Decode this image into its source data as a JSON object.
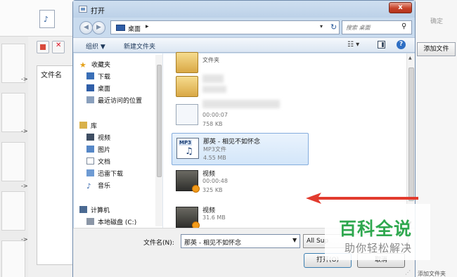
{
  "background": {
    "right_top_button": "确定",
    "add_file_button": "添加文件",
    "column_header": "文件名",
    "arrow_glyph": "->",
    "bottom_right_text": "添加文件夹"
  },
  "dialog": {
    "title": "打开",
    "close_glyph": "x",
    "address_location": "桌面",
    "search_placeholder": "搜索 桌面",
    "toolbar": {
      "organize": "组织 ▼",
      "new_folder": "新建文件夹",
      "view_glyph": "☷ ▾",
      "help_glyph": "?"
    },
    "nav_pane": {
      "favorites_header": "收藏夹",
      "favorites": [
        "下载",
        "桌面",
        "最近访问的位置"
      ],
      "libraries_header": "库",
      "libraries": [
        "视频",
        "图片",
        "文档",
        "迅雷下载",
        "音乐"
      ],
      "computer_header": "计算机",
      "computer_items": [
        "本地磁盘 (C:)"
      ]
    },
    "files": [
      {
        "name": "",
        "type": "文件夹",
        "size": "",
        "icon": "folder-icon"
      },
      {
        "name": "",
        "type": "",
        "size": "",
        "icon": "folder-icon"
      },
      {
        "name": "",
        "type": "00:00:07",
        "size": "758 KB",
        "icon": "audio-file-icon"
      },
      {
        "name": "那英 - 相见不如怀念",
        "type": "MP3文件",
        "size": "4.55 MB",
        "icon": "mp3-icon",
        "selected": true
      },
      {
        "name": "视频",
        "type": "00:00:48",
        "size": "325 KB",
        "icon": "video-thumbnail-icon"
      },
      {
        "name": "视频",
        "type": "31.6 MB",
        "size": "",
        "icon": "video-thumbnail-icon"
      }
    ],
    "filename_label": "文件名(N):",
    "filename_value": "那英 - 相见不如怀念",
    "filetype_value": "All Sup",
    "open_button": "打开(O)",
    "cancel_button": "取消"
  },
  "watermark": {
    "main": "百科全说",
    "sub": "助你轻松解决"
  },
  "colors": {
    "selection_border": "#84acdd",
    "red_arrow": "#e23b2e",
    "watermark_green": "#2fa84f"
  }
}
